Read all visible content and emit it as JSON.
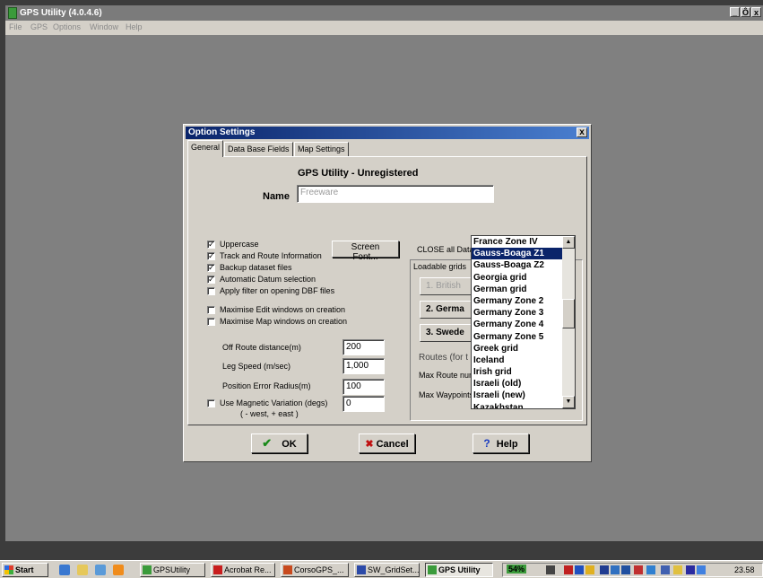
{
  "app": {
    "title": "GPS Utility (4.0.4.6)",
    "controls": [
      "_",
      "Ô",
      "x"
    ],
    "menu": [
      "File",
      "GPS",
      "Options",
      "Window",
      "Help"
    ]
  },
  "dialog": {
    "title": "Option Settings",
    "close": "x",
    "tabs": [
      "General",
      "Data Base Fields",
      "Map Settings"
    ],
    "heading": "GPS Utility - Unregistered",
    "name_label": "Name",
    "name_value": "Freeware",
    "screen_font_button": "Screen Font...",
    "checkboxes": [
      {
        "label": "Uppercase",
        "checked": true,
        "mark": "✓"
      },
      {
        "label": "Track and Route Information",
        "checked": true,
        "mark": "✓"
      },
      {
        "label": "Backup dataset files",
        "checked": true,
        "mark": "✓"
      },
      {
        "label": "Automatic Datum selection",
        "checked": true,
        "mark": "✓"
      },
      {
        "label": "Apply filter on opening DBF files",
        "checked": false,
        "mark": ""
      },
      {
        "label": "Maximise Edit windows on creation",
        "checked": false,
        "mark": ""
      },
      {
        "label": "Maximise Map windows on creation",
        "checked": false,
        "mark": ""
      },
      {
        "label": "Use Magnetic Variation (degs)",
        "checked": false,
        "mark": ""
      }
    ],
    "magnetic_hint": "( - west, + east )",
    "fields": [
      {
        "label": "Off Route distance(m)",
        "value": "200"
      },
      {
        "label": "Leg Speed (m/sec)",
        "value": "1,000"
      },
      {
        "label": "Position Error Radius(m)",
        "value": "100"
      },
      {
        "label": "",
        "value": "0"
      }
    ],
    "right_panel": {
      "close_all": "CLOSE all Data",
      "loadable_grids": "Loadable grids",
      "grid_slots": [
        "1. British",
        "2. Germa",
        "3. Swede"
      ],
      "routes": "Routes (for t",
      "max_route": "Max Route num",
      "max_waypoints": "Max Waypoints"
    },
    "grid_list": {
      "items": [
        "France Zone IV",
        "Gauss-Boaga Z1",
        "Gauss-Boaga Z2",
        "Georgia grid",
        "German grid",
        "Germany Zone 2",
        "Germany Zone 3",
        "Germany Zone 4",
        "Germany Zone 5",
        "Greek grid",
        "Iceland",
        "Irish grid",
        "Israeli (old)",
        "Israeli (new)",
        "Kazakhstan"
      ],
      "selected": "Gauss-Boaga Z1",
      "scroll_up": "▲",
      "scroll_down": "▼"
    },
    "buttons": {
      "ok": "OK",
      "cancel": "Cancel",
      "help": "Help",
      "ok_icon": "✔",
      "cancel_icon": "✖",
      "help_icon": "?"
    }
  },
  "taskbar": {
    "start": "Start",
    "tasks": [
      {
        "label": "GPSUtility",
        "active": false
      },
      {
        "label": "Acrobat Re...",
        "active": false
      },
      {
        "label": "CorsoGPS_...",
        "active": false
      },
      {
        "label": "SW_GridSet...",
        "active": false
      },
      {
        "label": "GPS Utility",
        "active": true
      }
    ],
    "battery": "54%",
    "clock": "23.58"
  },
  "colors": {
    "desktop": "#808080",
    "dialog_face": "#d4d0c8",
    "selection": "#0a246a"
  }
}
